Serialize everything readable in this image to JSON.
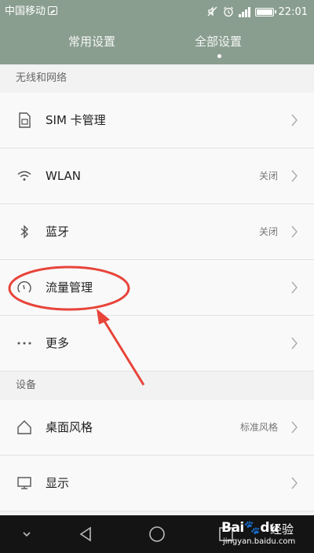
{
  "status_bar": {
    "carrier": "中国移动",
    "time": "22:01"
  },
  "tabs": [
    {
      "label": "常用设置",
      "active": false
    },
    {
      "label": "全部设置",
      "active": true
    }
  ],
  "sections": [
    {
      "header": "无线和网络",
      "items": [
        {
          "label": "SIM 卡管理",
          "value": "",
          "icon": "sim-card-icon"
        },
        {
          "label": "WLAN",
          "value": "关闭",
          "icon": "wifi-icon"
        },
        {
          "label": "蓝牙",
          "value": "关闭",
          "icon": "bluetooth-icon"
        },
        {
          "label": "流量管理",
          "value": "",
          "icon": "data-usage-icon"
        },
        {
          "label": "更多",
          "value": "",
          "icon": "more-icon"
        }
      ]
    },
    {
      "header": "设备",
      "items": [
        {
          "label": "桌面风格",
          "value": "标准风格",
          "icon": "home-icon"
        },
        {
          "label": "显示",
          "value": "",
          "icon": "display-icon"
        }
      ]
    }
  ],
  "nav_bar": [
    "back-icon",
    "home-circle-icon",
    "recents-icon",
    "collapse-icon"
  ],
  "annotation": {
    "target": "流量管理",
    "color": "#e8443a"
  },
  "watermark": {
    "logo": "Bai🐾du",
    "text": "经验",
    "url": "jingyan.baidu.com"
  },
  "colors": {
    "header_bg": "#8a9e90",
    "list_bg": "#f9f9f9",
    "section_bg": "#f2f2f2",
    "navbar_bg": "#141414"
  }
}
